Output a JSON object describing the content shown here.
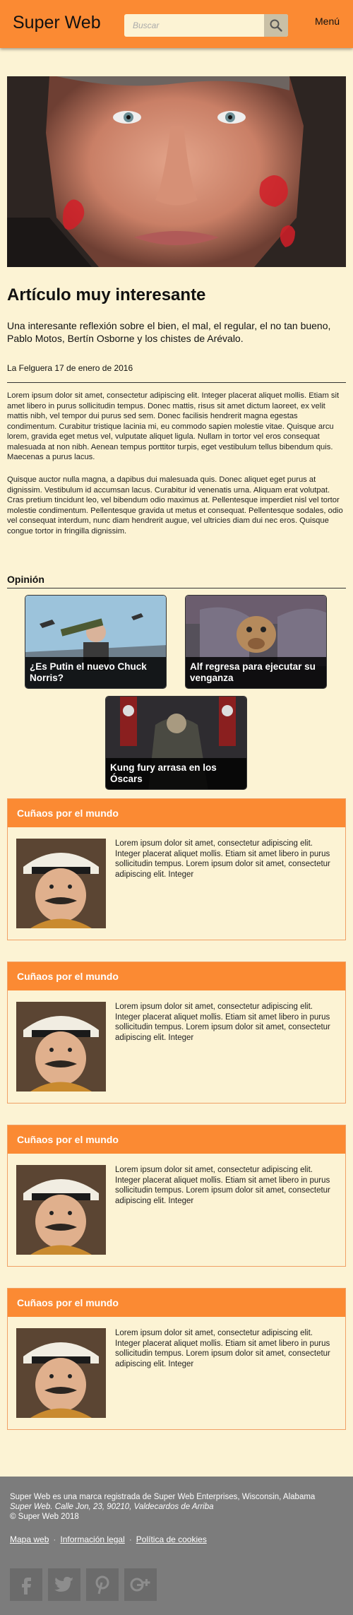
{
  "header": {
    "logo": "Super Web",
    "search_placeholder": "Buscar",
    "menu_label": "Menú"
  },
  "article": {
    "title": "Artículo muy interesante",
    "subtitle": "Una interesante reflexión sobre el bien, el mal, el regular, el no tan bueno, Pablo Motos, Bertín Osborne y los chistes de Arévalo.",
    "dateline": "La Felguera 17 de enero de 2016",
    "paragraph_1": "Lorem ipsum dolor sit amet, consectetur adipiscing elit. Integer placerat aliquet mollis. Etiam sit amet libero in purus sollicitudin tempus. Donec mattis, risus sit amet dictum laoreet, ex velit mattis nibh, vel tempor dui purus sed sem. Donec facilisis hendrerit magna egestas condimentum. Curabitur tristique lacinia mi, eu commodo sapien molestie vitae. Quisque arcu lorem, gravida eget metus vel, vulputate aliquet ligula. Nullam in tortor vel eros consequat malesuada at non nibh. Aenean tempus porttitor turpis, eget vestibulum tellus bibendum quis. Maecenas a purus lacus.",
    "paragraph_2": "Quisque auctor nulla magna, a dapibus dui malesuada quis. Donec aliquet eget purus at dignissim. Vestibulum id accumsan lacus. Curabitur id venenatis urna. Aliquam erat volutpat. Cras pretium tincidunt leo, vel bibendum odio maximus at. Pellentesque imperdiet nisl vel tortor molestie condimentum. Pellentesque gravida ut metus et consequat. Pellentesque sodales, odio vel consequat interdum, nunc diam hendrerit augue, vel ultricies diam dui nec eros. Quisque congue tortor in fringilla dignissim."
  },
  "opinion": {
    "title": "Opinión",
    "cards": [
      {
        "caption": "¿Es Putin el nuevo Chuck Norris?"
      },
      {
        "caption": "Alf regresa para ejecutar su venganza"
      },
      {
        "caption": "Kung fury arrasa en los Óscars"
      }
    ]
  },
  "cunados": [
    {
      "title": "Cuñaos por el mundo",
      "text": "Lorem ipsum dolor sit amet, consectetur adipiscing elit. Integer placerat aliquet mollis. Etiam sit amet libero in purus sollicitudin tempus. Lorem ipsum dolor sit amet, consectetur adipiscing elit. Integer"
    },
    {
      "title": "Cuñaos por el mundo",
      "text": "Lorem ipsum dolor sit amet, consectetur adipiscing elit. Integer placerat aliquet mollis. Etiam sit amet libero in purus sollicitudin tempus. Lorem ipsum dolor sit amet, consectetur adipiscing elit. Integer"
    },
    {
      "title": "Cuñaos por el mundo",
      "text": "Lorem ipsum dolor sit amet, consectetur adipiscing elit. Integer placerat aliquet mollis. Etiam sit amet libero in purus sollicitudin tempus. Lorem ipsum dolor sit amet, consectetur adipiscing elit. Integer"
    },
    {
      "title": "Cuñaos por el mundo",
      "text": "Lorem ipsum dolor sit amet, consectetur adipiscing elit. Integer placerat aliquet mollis. Etiam sit amet libero in purus sollicitudin tempus. Lorem ipsum dolor sit amet, consectetur adipiscing elit. Integer"
    }
  ],
  "footer": {
    "line_1": "Super Web es una marca registrada de Super Web Enterprises, Wisconsin, Alabama",
    "line_2": "Super Web. Calle Jon, 23, 90210, Valdecardos de Arriba",
    "line_3": "© Super Web 2018",
    "links": [
      "Mapa web",
      "Información legal",
      "Política de cookies"
    ],
    "separator": "·",
    "social_icons": [
      "facebook-icon",
      "twitter-icon",
      "pinterest-icon",
      "google-plus-icon"
    ]
  },
  "colors": {
    "brand_orange": "#fb8a33",
    "background_cream": "#fcf3d4",
    "footer_gray": "#7c7c7c"
  }
}
